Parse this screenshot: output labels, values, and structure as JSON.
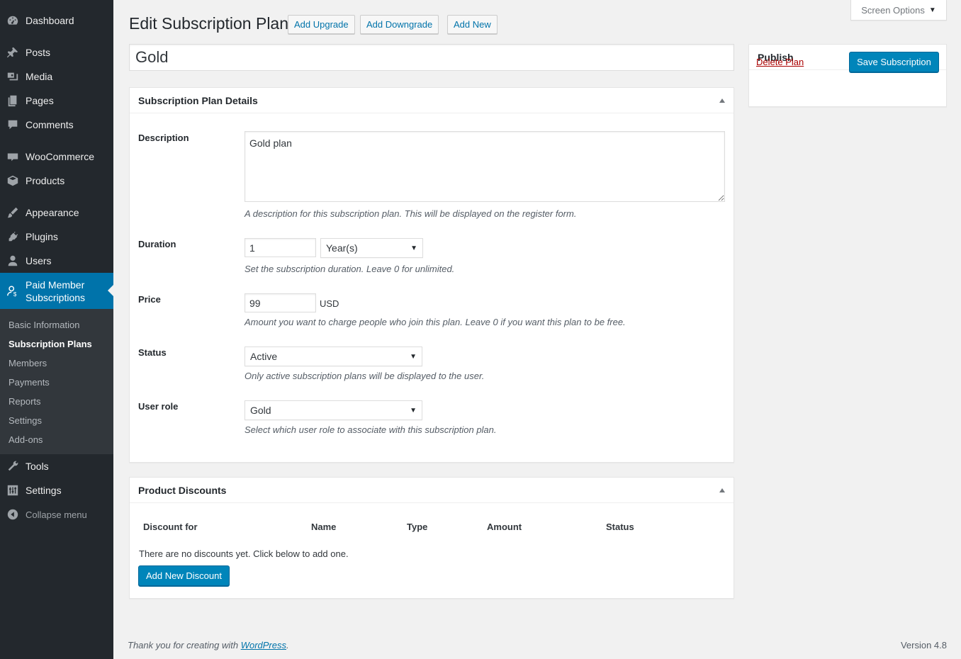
{
  "sidebar": {
    "items": [
      {
        "label": "Dashboard",
        "icon": "dashboard-icon"
      },
      {
        "label": "Posts",
        "icon": "pin-icon"
      },
      {
        "label": "Media",
        "icon": "media-icon"
      },
      {
        "label": "Pages",
        "icon": "pages-icon"
      },
      {
        "label": "Comments",
        "icon": "comment-icon"
      },
      {
        "label": "WooCommerce",
        "icon": "woocommerce-icon"
      },
      {
        "label": "Products",
        "icon": "box-icon"
      },
      {
        "label": "Appearance",
        "icon": "brush-icon"
      },
      {
        "label": "Plugins",
        "icon": "plug-icon"
      },
      {
        "label": "Users",
        "icon": "user-icon"
      },
      {
        "label": "Paid Member Subscriptions",
        "icon": "member-icon"
      },
      {
        "label": "Tools",
        "icon": "wrench-icon"
      },
      {
        "label": "Settings",
        "icon": "sliders-icon"
      },
      {
        "label": "Collapse menu",
        "icon": "collapse-icon"
      }
    ],
    "submenu": [
      "Basic Information",
      "Subscription Plans",
      "Members",
      "Payments",
      "Reports",
      "Settings",
      "Add-ons"
    ],
    "colors": {
      "bg": "#23282d",
      "current": "#0073aa",
      "submenu_bg": "#32373c"
    }
  },
  "header": {
    "title": "Edit Subscription Plan",
    "actions": [
      "Add Upgrade",
      "Add Downgrade",
      "Add New"
    ],
    "screen_options": "Screen Options"
  },
  "plan_title": "Gold",
  "details": {
    "heading": "Subscription Plan Details",
    "description": {
      "label": "Description",
      "value": "Gold plan",
      "help": "A description for this subscription plan. This will be displayed on the register form."
    },
    "duration": {
      "label": "Duration",
      "value": "1",
      "unit": "Year(s)",
      "help": "Set the subscription duration. Leave 0 for unlimited."
    },
    "price": {
      "label": "Price",
      "value": "99",
      "currency": "USD",
      "help": "Amount you want to charge people who join this plan. Leave 0 if you want this plan to be free."
    },
    "status": {
      "label": "Status",
      "value": "Active",
      "help": "Only active subscription plans will be displayed to the user."
    },
    "user_role": {
      "label": "User role",
      "value": "Gold",
      "help": "Select which user role to associate with this subscription plan."
    }
  },
  "discounts": {
    "heading": "Product Discounts",
    "columns": [
      "Discount for",
      "Name",
      "Type",
      "Amount",
      "Status"
    ],
    "empty_text": "There are no discounts yet. Click below to add one.",
    "add_button": "Add New Discount"
  },
  "publish": {
    "heading": "Publish",
    "delete_label": "Delete Plan",
    "save_label": "Save Subscription"
  },
  "footer": {
    "thanks_prefix": "Thank you for creating with ",
    "thanks_link": "WordPress",
    "thanks_suffix": ".",
    "version": "Version 4.8"
  }
}
